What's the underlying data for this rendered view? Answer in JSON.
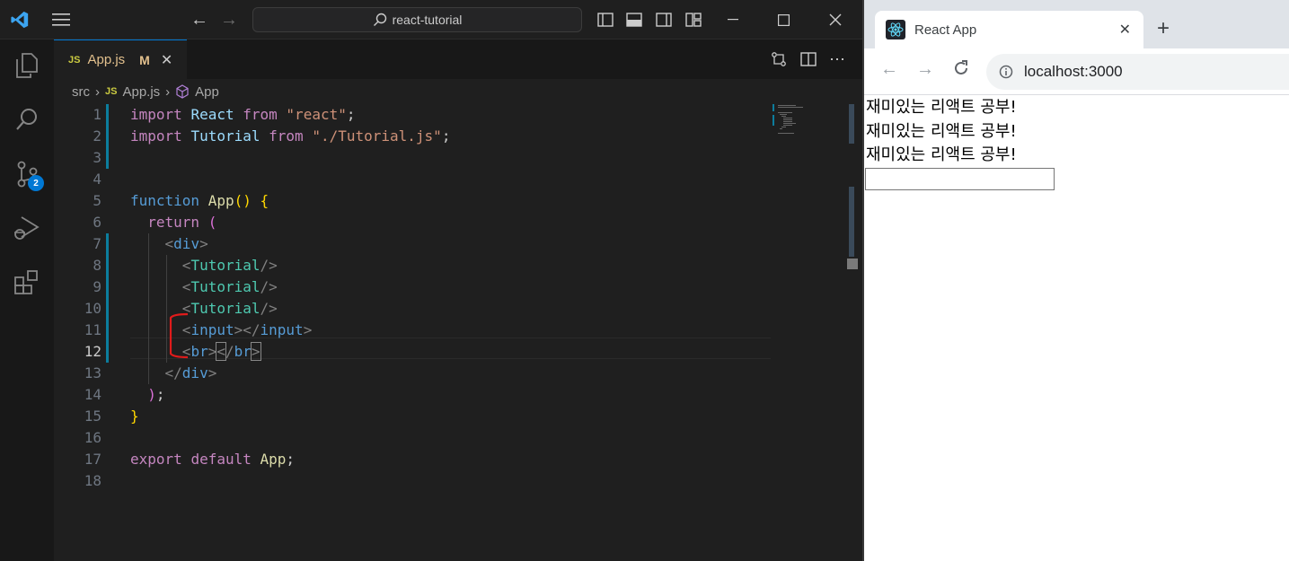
{
  "vscode": {
    "search_text": "react-tutorial",
    "scm_badge": "2",
    "tab": {
      "lang": "JS",
      "filename": "App.js",
      "status": "M"
    },
    "breadcrumb": {
      "folder": "src",
      "lang": "JS",
      "file": "App.js",
      "symbol": "App"
    },
    "line_numbers": [
      "1",
      "2",
      "3",
      "4",
      "5",
      "6",
      "7",
      "8",
      "9",
      "10",
      "11",
      "12",
      "13",
      "14",
      "15",
      "16",
      "17",
      "18"
    ],
    "active_line": "12"
  },
  "browser": {
    "tab_title": "React App",
    "url": "localhost:3000",
    "page_lines": [
      "재미있는 리액트 공부!",
      "재미있는 리액트 공부!",
      "재미있는 리액트 공부!"
    ]
  },
  "colors": {
    "accent": "#0078d4",
    "editor_bg": "#1f1f1f",
    "browser_bg": "#ffffff"
  }
}
